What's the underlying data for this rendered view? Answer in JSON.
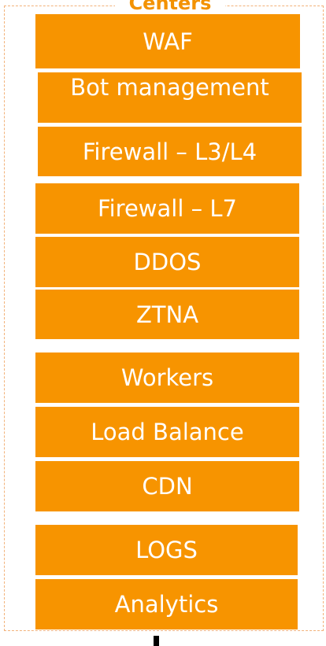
{
  "frame": {
    "title": "Centers"
  },
  "services": [
    {
      "label": "WAF"
    },
    {
      "label": "Bot management"
    },
    {
      "label": "Firewall – L3/L4"
    },
    {
      "label": "Firewall – L7"
    },
    {
      "label": "DDOS"
    },
    {
      "label": "ZTNA"
    },
    {
      "label": "Workers"
    },
    {
      "label": "Load Balance"
    },
    {
      "label": "CDN"
    },
    {
      "label": "LOGS"
    },
    {
      "label": "Analytics"
    }
  ],
  "colors": {
    "box_fill": "#f79400",
    "box_text": "#ffffff",
    "frame_border": "#f2b27a",
    "title_text": "#f39200"
  }
}
